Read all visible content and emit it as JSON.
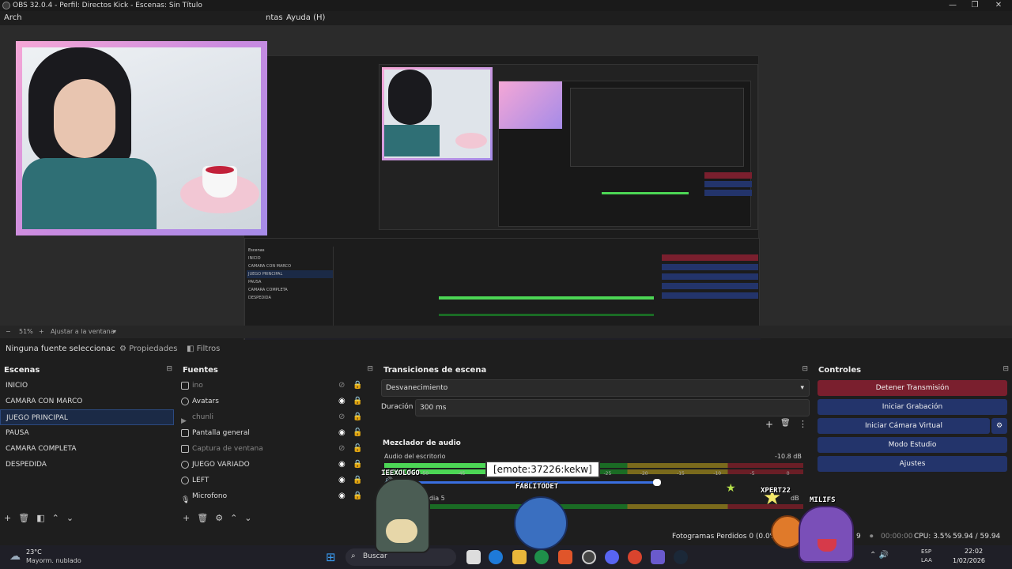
{
  "window": {
    "title": "OBS 32.0.4 - Perfil: Directos Kick - Escenas: Sin Título",
    "controls": [
      "—",
      "❐",
      "✕"
    ]
  },
  "menu": {
    "items": [
      "Arch",
      "ntas",
      "Ayuda (H)"
    ]
  },
  "zoom": {
    "level": "51%",
    "fit_label": "Ajustar a la ventana"
  },
  "source_bar": {
    "none_selected": "Ninguna fuente seleccionac",
    "properties": "Propiedades",
    "filters": "Filtros"
  },
  "scenes": {
    "title": "Escenas",
    "items": [
      "INICIO",
      "CAMARA CON MARCO",
      "JUEGO PRINCIPAL",
      "PAUSA",
      "CAMARA COMPLETA",
      "DESPEDIDA"
    ],
    "selected_index": 2
  },
  "sources": {
    "title": "Fuentes",
    "items": [
      {
        "label": "ino",
        "visible": false
      },
      {
        "label": "Avatars",
        "visible": true
      },
      {
        "label": "chunli",
        "visible": false
      },
      {
        "label": "Pantalla general",
        "visible": true
      },
      {
        "label": "Captura de ventana",
        "visible": false
      },
      {
        "label": "JUEGO VARIADO",
        "visible": true
      },
      {
        "label": "LEFT",
        "visible": true
      },
      {
        "label": "Microfono",
        "visible": true
      }
    ]
  },
  "transitions": {
    "title": "Transiciones de escena",
    "selected": "Desvanecimiento",
    "duration_label": "Duración",
    "duration_value": "300 ms"
  },
  "mixer": {
    "title": "Mezclador de audio",
    "channels": [
      {
        "name": "Audio del escritorio",
        "db": "-10.8 dB",
        "level": 0.26
      },
      {
        "name": "edia 5",
        "db": "dB",
        "level": 0.0
      }
    ],
    "scale": [
      "-55",
      "-50",
      "-45",
      "-40",
      "-35",
      "-30",
      "-25",
      "-20",
      "-15",
      "-10",
      "-5",
      "0"
    ]
  },
  "controls": {
    "title": "Controles",
    "stop_stream": "Detener Transmisión",
    "start_recording": "Iniciar Grabación",
    "start_virtual_cam": "Iniciar Cámara Virtual",
    "studio_mode": "Modo Estudio",
    "settings": "Ajustes"
  },
  "status": {
    "dropped_frames": "Fotogramas Perdidos 0 (0.0%)",
    "time": "00:00:00",
    "cpu": "CPU: 3.5%",
    "fps": "59.94 / 59.94 FPS",
    "left_num": "9"
  },
  "overlay": {
    "emote_tooltip": "[emote:37226:kekw]",
    "chat_names": [
      "IEEXOLOGO",
      "FABLITODET",
      "XPERT22",
      "MILIFS"
    ]
  },
  "taskbar": {
    "weather_temp": "23°C",
    "weather_desc": "Mayorm. nublado",
    "search": "Buscar",
    "lang": "ESP",
    "lang2": "LAA",
    "clock_time": "22:02",
    "clock_date": "1/02/2026"
  },
  "colors": {
    "stop_stream_bg": "#7a1f2e",
    "button_blue": "#23346b",
    "selected_scene": "#1b2a46",
    "cam_frame": "#c98be0"
  }
}
